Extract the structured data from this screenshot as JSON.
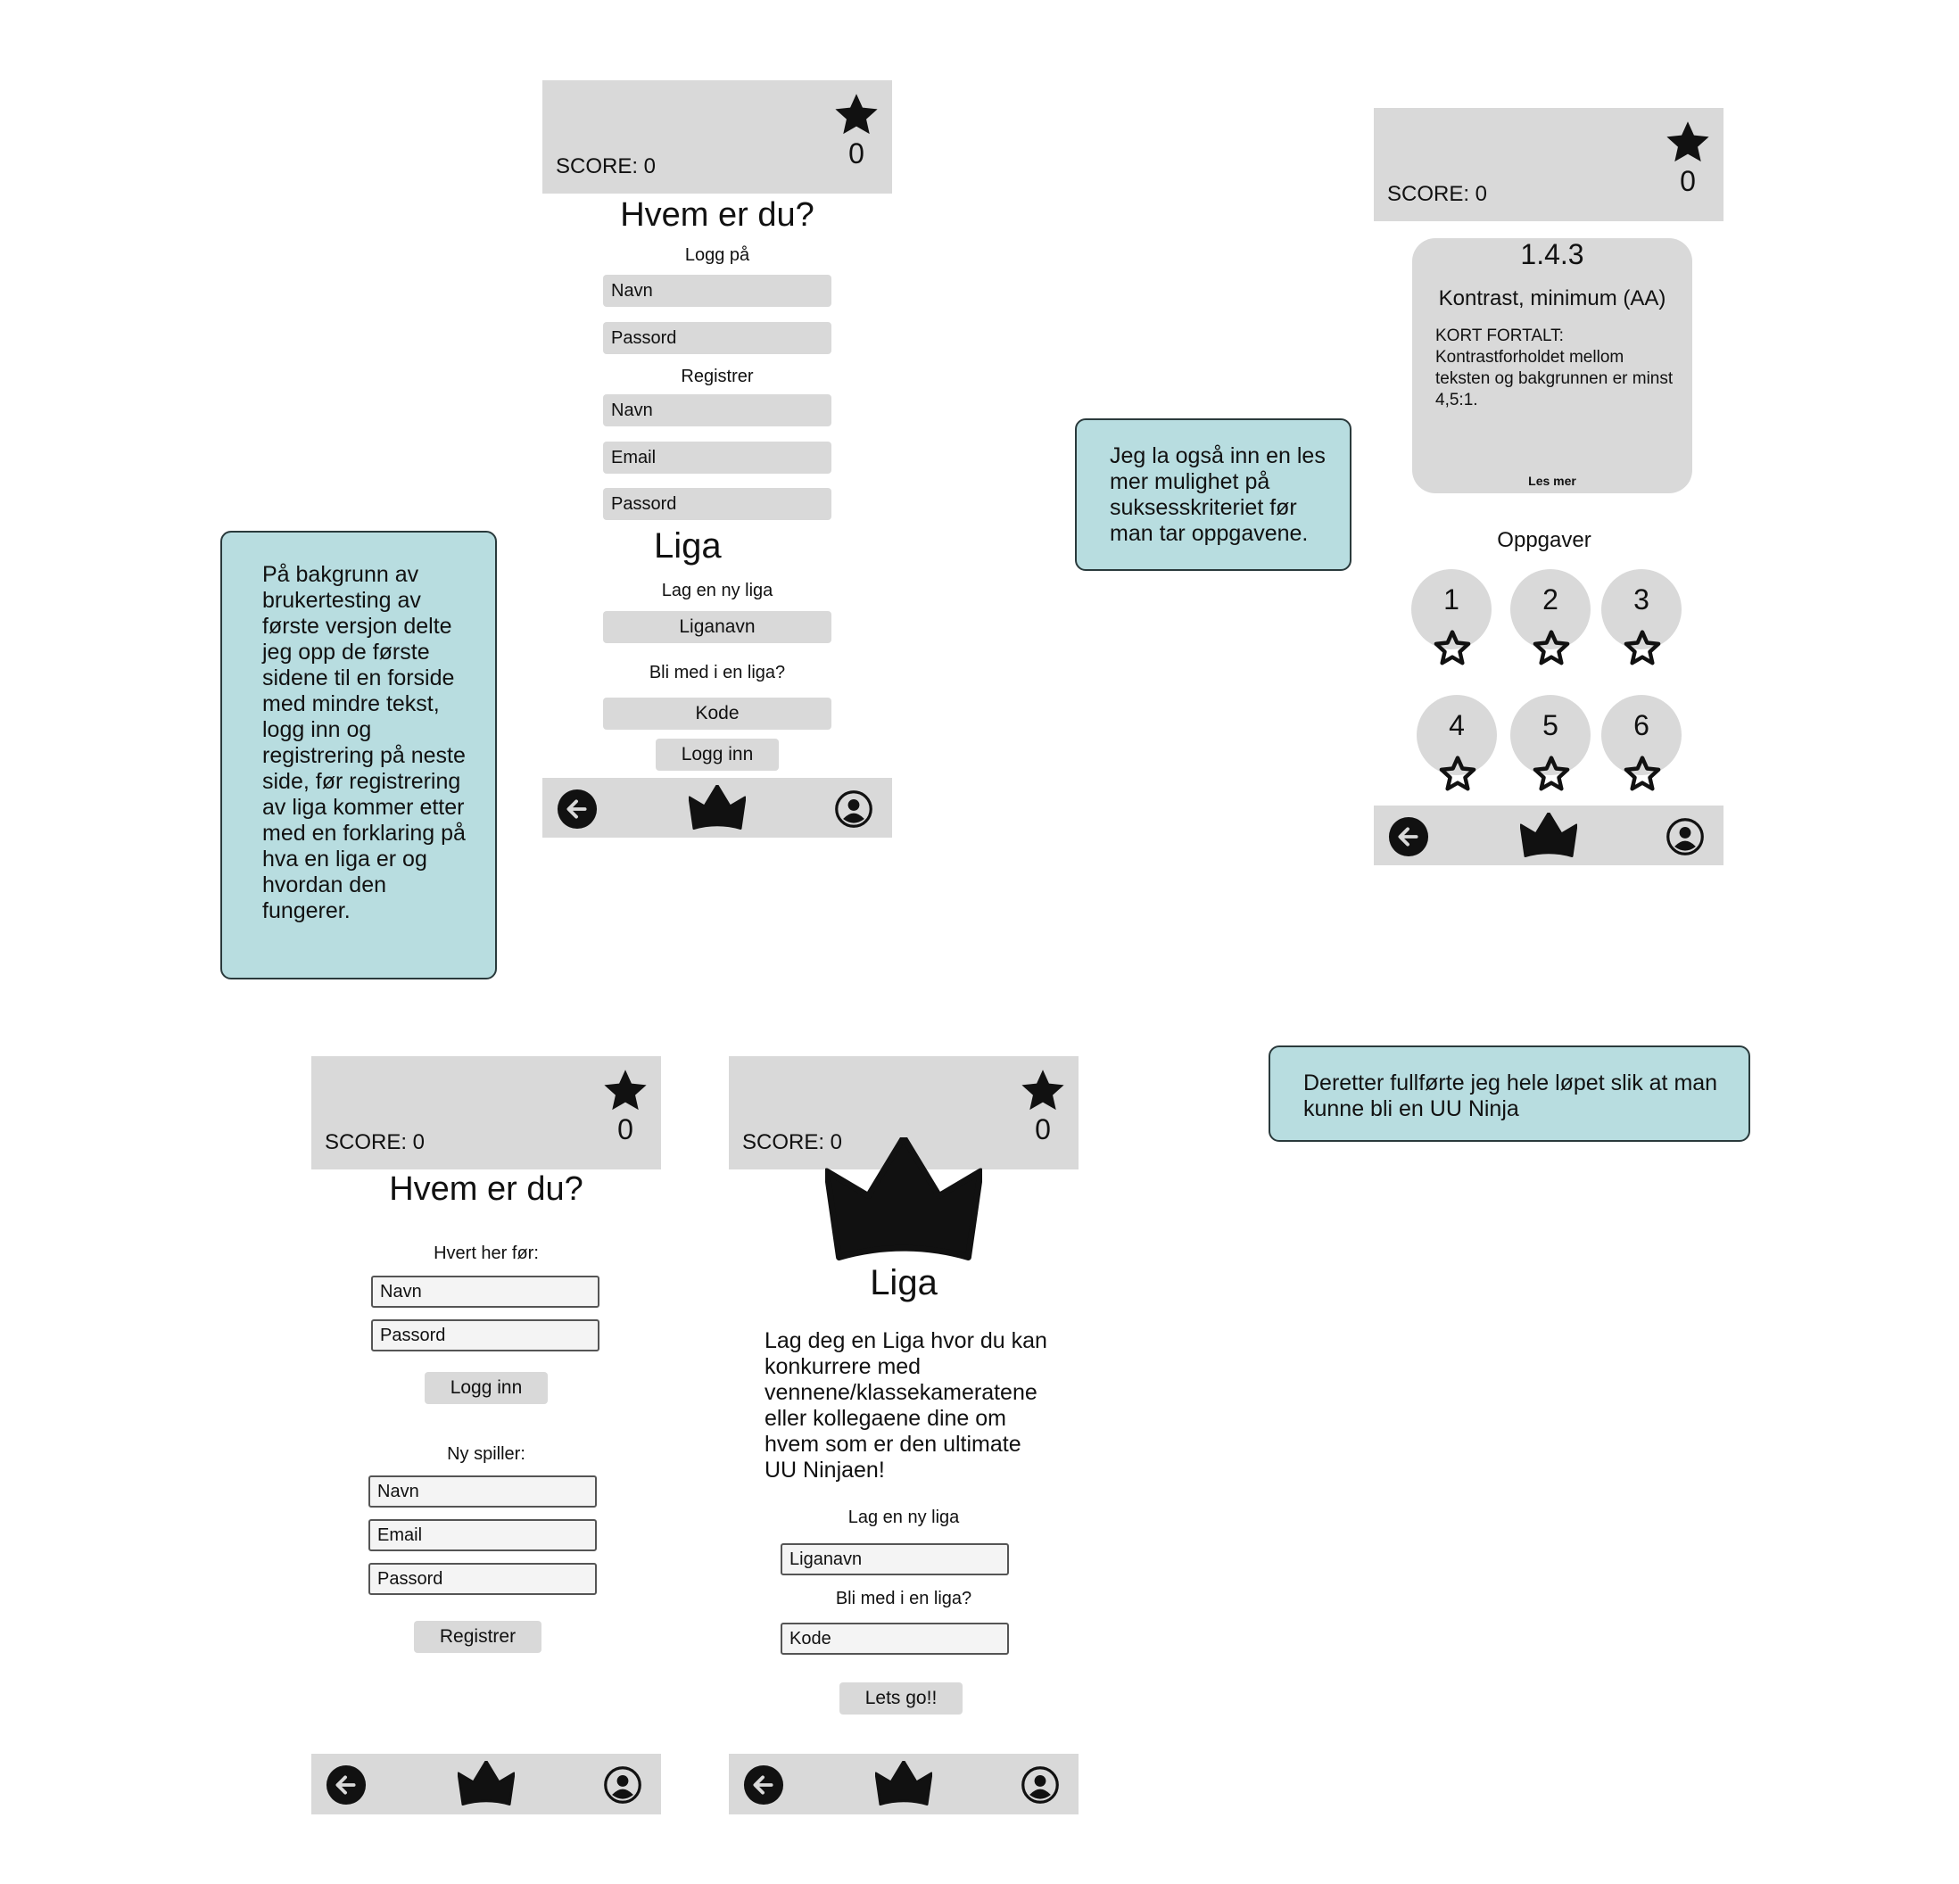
{
  "common": {
    "score_label": "SCORE: 0",
    "star_count": "0"
  },
  "screen1": {
    "title": "Hvem er du?",
    "login_heading": "Logg på",
    "login_name_placeholder": "Navn",
    "login_password_placeholder": "Passord",
    "register_heading": "Registrer",
    "register_name_placeholder": "Navn",
    "register_email_placeholder": "Email",
    "register_password_placeholder": "Passord",
    "liga_title": "Liga",
    "new_liga_heading": "Lag en ny liga",
    "liga_name_button": "Liganavn",
    "join_heading": "Bli med i en liga?",
    "code_button": "Kode",
    "login_button": "Logg inn"
  },
  "screen2": {
    "card_number": "1.4.3",
    "card_title": "Kontrast, minimum (AA)",
    "card_summary": "KORT FORTALT: Kontrastforholdet mellom teksten og bakgrunnen er minst 4,5:1.",
    "card_link": "Les mer",
    "tasks_heading": "Oppgaver",
    "tasks": [
      "1",
      "2",
      "3",
      "4",
      "5",
      "6"
    ]
  },
  "screen3": {
    "title": "Hvem er du?",
    "returning_heading": "Hvert her før:",
    "login_name_placeholder": "Navn",
    "login_password_placeholder": "Passord",
    "login_button": "Logg inn",
    "new_player_heading": "Ny spiller:",
    "reg_name_placeholder": "Navn",
    "reg_email_placeholder": "Email",
    "reg_password_placeholder": "Passord",
    "register_button": "Registrer"
  },
  "screen4": {
    "title": "Liga",
    "description": "Lag deg en Liga hvor du kan konkurrere med vennene/klassekameratene eller kollegaene dine om hvem som er den ultimate UU Ninjaen!",
    "new_liga_heading": "Lag en ny liga",
    "liga_name_placeholder": "Liganavn",
    "join_heading": "Bli med i en liga?",
    "code_placeholder": "Kode",
    "go_button": "Lets go!!"
  },
  "notes": {
    "left": "På bakgrunn av brukertesting av første versjon delte jeg opp de første sidene til en forside med mindre tekst, logg inn og registrering på neste side, før registrering av liga kommer etter med en forklaring på hva en liga er og hvordan den fungerer.",
    "middle": "Jeg la også inn en les mer mulighet på suksesskriteriet før man tar oppgavene.",
    "right": "Deretter fullførte jeg hele løpet slik at man kunne bli en UU Ninja"
  },
  "colors": {
    "screen_gray": "#d9d9d9",
    "note_teal": "#b8dde0",
    "icon_black": "#111111"
  },
  "icons": [
    "star-icon",
    "star-outline-icon",
    "crown-icon",
    "back-arrow-icon",
    "profile-icon"
  ]
}
